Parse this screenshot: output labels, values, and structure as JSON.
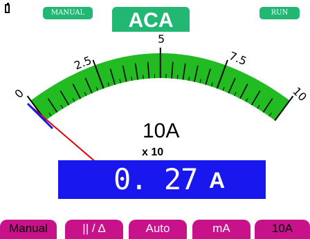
{
  "header": {
    "mode_left": "MANUAL",
    "mode_title": "ACA",
    "mode_right": "RUN"
  },
  "meter": {
    "scale_labels": [
      "0",
      "2.5",
      "5",
      "7.5",
      "10"
    ],
    "range_label": "10A",
    "multiplier": "x 10",
    "needle_fraction": 0.027,
    "colors": {
      "arc": "#22bb22",
      "needle": "#e00000",
      "ticks": "#000000"
    }
  },
  "reading": {
    "value": "0. 27",
    "unit": "A",
    "background": "#1717ee"
  },
  "softkeys": [
    {
      "label": "Manual"
    },
    {
      "label": "|| / Δ"
    },
    {
      "label": "Auto"
    },
    {
      "label": "mA"
    },
    {
      "label": "10A"
    }
  ],
  "colors": {
    "accent_green": "#22b873",
    "softkey": "#c8128a"
  },
  "icons": {
    "battery": "battery-icon"
  }
}
